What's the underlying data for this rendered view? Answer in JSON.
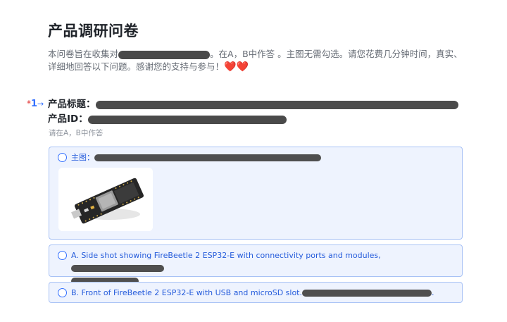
{
  "survey": {
    "title": "产品调研问卷",
    "intro_part1": "本问卷旨在收集对",
    "intro_part2": "。在A，B中作答 。主图无需勾选。请您花费几分钟时间，真实、详细地回答以下问题。感谢您的支持与参与！",
    "hearts": "❤️❤️"
  },
  "question": {
    "required_mark": "*",
    "number": "1",
    "arrow": "→",
    "title_label": "产品标题：",
    "id_label": "产品ID：",
    "hint": "请在A，B中作答"
  },
  "options": {
    "main": {
      "label": "主图："
    },
    "a": {
      "label": "A. Side shot showing FireBeetle 2 ESP32-E with connectivity ports and modules,",
      "suffix": "."
    },
    "b": {
      "label": "B. Front of FireBeetle 2 ESP32-E with USB and microSD slot.",
      "suffix": "."
    }
  },
  "colors": {
    "accent": "#3370ff",
    "option_bg": "#eef3fe",
    "option_border": "#a8c2f5",
    "required": "#e02b2b"
  }
}
